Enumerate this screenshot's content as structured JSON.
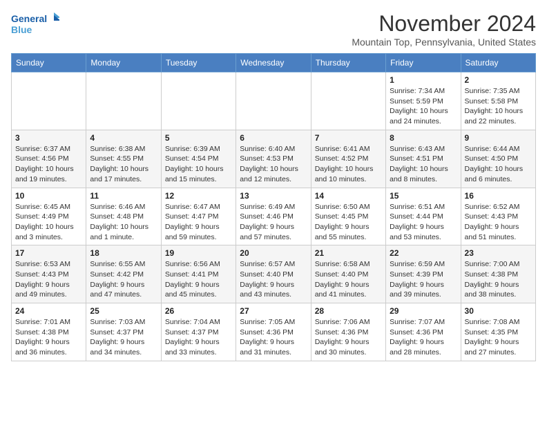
{
  "logo": {
    "line1": "General",
    "line2": "Blue"
  },
  "title": "November 2024",
  "location": "Mountain Top, Pennsylvania, United States",
  "days_of_week": [
    "Sunday",
    "Monday",
    "Tuesday",
    "Wednesday",
    "Thursday",
    "Friday",
    "Saturday"
  ],
  "weeks": [
    [
      {
        "day": "",
        "info": ""
      },
      {
        "day": "",
        "info": ""
      },
      {
        "day": "",
        "info": ""
      },
      {
        "day": "",
        "info": ""
      },
      {
        "day": "",
        "info": ""
      },
      {
        "day": "1",
        "info": "Sunrise: 7:34 AM\nSunset: 5:59 PM\nDaylight: 10 hours\nand 24 minutes."
      },
      {
        "day": "2",
        "info": "Sunrise: 7:35 AM\nSunset: 5:58 PM\nDaylight: 10 hours\nand 22 minutes."
      }
    ],
    [
      {
        "day": "3",
        "info": "Sunrise: 6:37 AM\nSunset: 4:56 PM\nDaylight: 10 hours\nand 19 minutes."
      },
      {
        "day": "4",
        "info": "Sunrise: 6:38 AM\nSunset: 4:55 PM\nDaylight: 10 hours\nand 17 minutes."
      },
      {
        "day": "5",
        "info": "Sunrise: 6:39 AM\nSunset: 4:54 PM\nDaylight: 10 hours\nand 15 minutes."
      },
      {
        "day": "6",
        "info": "Sunrise: 6:40 AM\nSunset: 4:53 PM\nDaylight: 10 hours\nand 12 minutes."
      },
      {
        "day": "7",
        "info": "Sunrise: 6:41 AM\nSunset: 4:52 PM\nDaylight: 10 hours\nand 10 minutes."
      },
      {
        "day": "8",
        "info": "Sunrise: 6:43 AM\nSunset: 4:51 PM\nDaylight: 10 hours\nand 8 minutes."
      },
      {
        "day": "9",
        "info": "Sunrise: 6:44 AM\nSunset: 4:50 PM\nDaylight: 10 hours\nand 6 minutes."
      }
    ],
    [
      {
        "day": "10",
        "info": "Sunrise: 6:45 AM\nSunset: 4:49 PM\nDaylight: 10 hours\nand 3 minutes."
      },
      {
        "day": "11",
        "info": "Sunrise: 6:46 AM\nSunset: 4:48 PM\nDaylight: 10 hours\nand 1 minute."
      },
      {
        "day": "12",
        "info": "Sunrise: 6:47 AM\nSunset: 4:47 PM\nDaylight: 9 hours\nand 59 minutes."
      },
      {
        "day": "13",
        "info": "Sunrise: 6:49 AM\nSunset: 4:46 PM\nDaylight: 9 hours\nand 57 minutes."
      },
      {
        "day": "14",
        "info": "Sunrise: 6:50 AM\nSunset: 4:45 PM\nDaylight: 9 hours\nand 55 minutes."
      },
      {
        "day": "15",
        "info": "Sunrise: 6:51 AM\nSunset: 4:44 PM\nDaylight: 9 hours\nand 53 minutes."
      },
      {
        "day": "16",
        "info": "Sunrise: 6:52 AM\nSunset: 4:43 PM\nDaylight: 9 hours\nand 51 minutes."
      }
    ],
    [
      {
        "day": "17",
        "info": "Sunrise: 6:53 AM\nSunset: 4:43 PM\nDaylight: 9 hours\nand 49 minutes."
      },
      {
        "day": "18",
        "info": "Sunrise: 6:55 AM\nSunset: 4:42 PM\nDaylight: 9 hours\nand 47 minutes."
      },
      {
        "day": "19",
        "info": "Sunrise: 6:56 AM\nSunset: 4:41 PM\nDaylight: 9 hours\nand 45 minutes."
      },
      {
        "day": "20",
        "info": "Sunrise: 6:57 AM\nSunset: 4:40 PM\nDaylight: 9 hours\nand 43 minutes."
      },
      {
        "day": "21",
        "info": "Sunrise: 6:58 AM\nSunset: 4:40 PM\nDaylight: 9 hours\nand 41 minutes."
      },
      {
        "day": "22",
        "info": "Sunrise: 6:59 AM\nSunset: 4:39 PM\nDaylight: 9 hours\nand 39 minutes."
      },
      {
        "day": "23",
        "info": "Sunrise: 7:00 AM\nSunset: 4:38 PM\nDaylight: 9 hours\nand 38 minutes."
      }
    ],
    [
      {
        "day": "24",
        "info": "Sunrise: 7:01 AM\nSunset: 4:38 PM\nDaylight: 9 hours\nand 36 minutes."
      },
      {
        "day": "25",
        "info": "Sunrise: 7:03 AM\nSunset: 4:37 PM\nDaylight: 9 hours\nand 34 minutes."
      },
      {
        "day": "26",
        "info": "Sunrise: 7:04 AM\nSunset: 4:37 PM\nDaylight: 9 hours\nand 33 minutes."
      },
      {
        "day": "27",
        "info": "Sunrise: 7:05 AM\nSunset: 4:36 PM\nDaylight: 9 hours\nand 31 minutes."
      },
      {
        "day": "28",
        "info": "Sunrise: 7:06 AM\nSunset: 4:36 PM\nDaylight: 9 hours\nand 30 minutes."
      },
      {
        "day": "29",
        "info": "Sunrise: 7:07 AM\nSunset: 4:36 PM\nDaylight: 9 hours\nand 28 minutes."
      },
      {
        "day": "30",
        "info": "Sunrise: 7:08 AM\nSunset: 4:35 PM\nDaylight: 9 hours\nand 27 minutes."
      }
    ]
  ]
}
